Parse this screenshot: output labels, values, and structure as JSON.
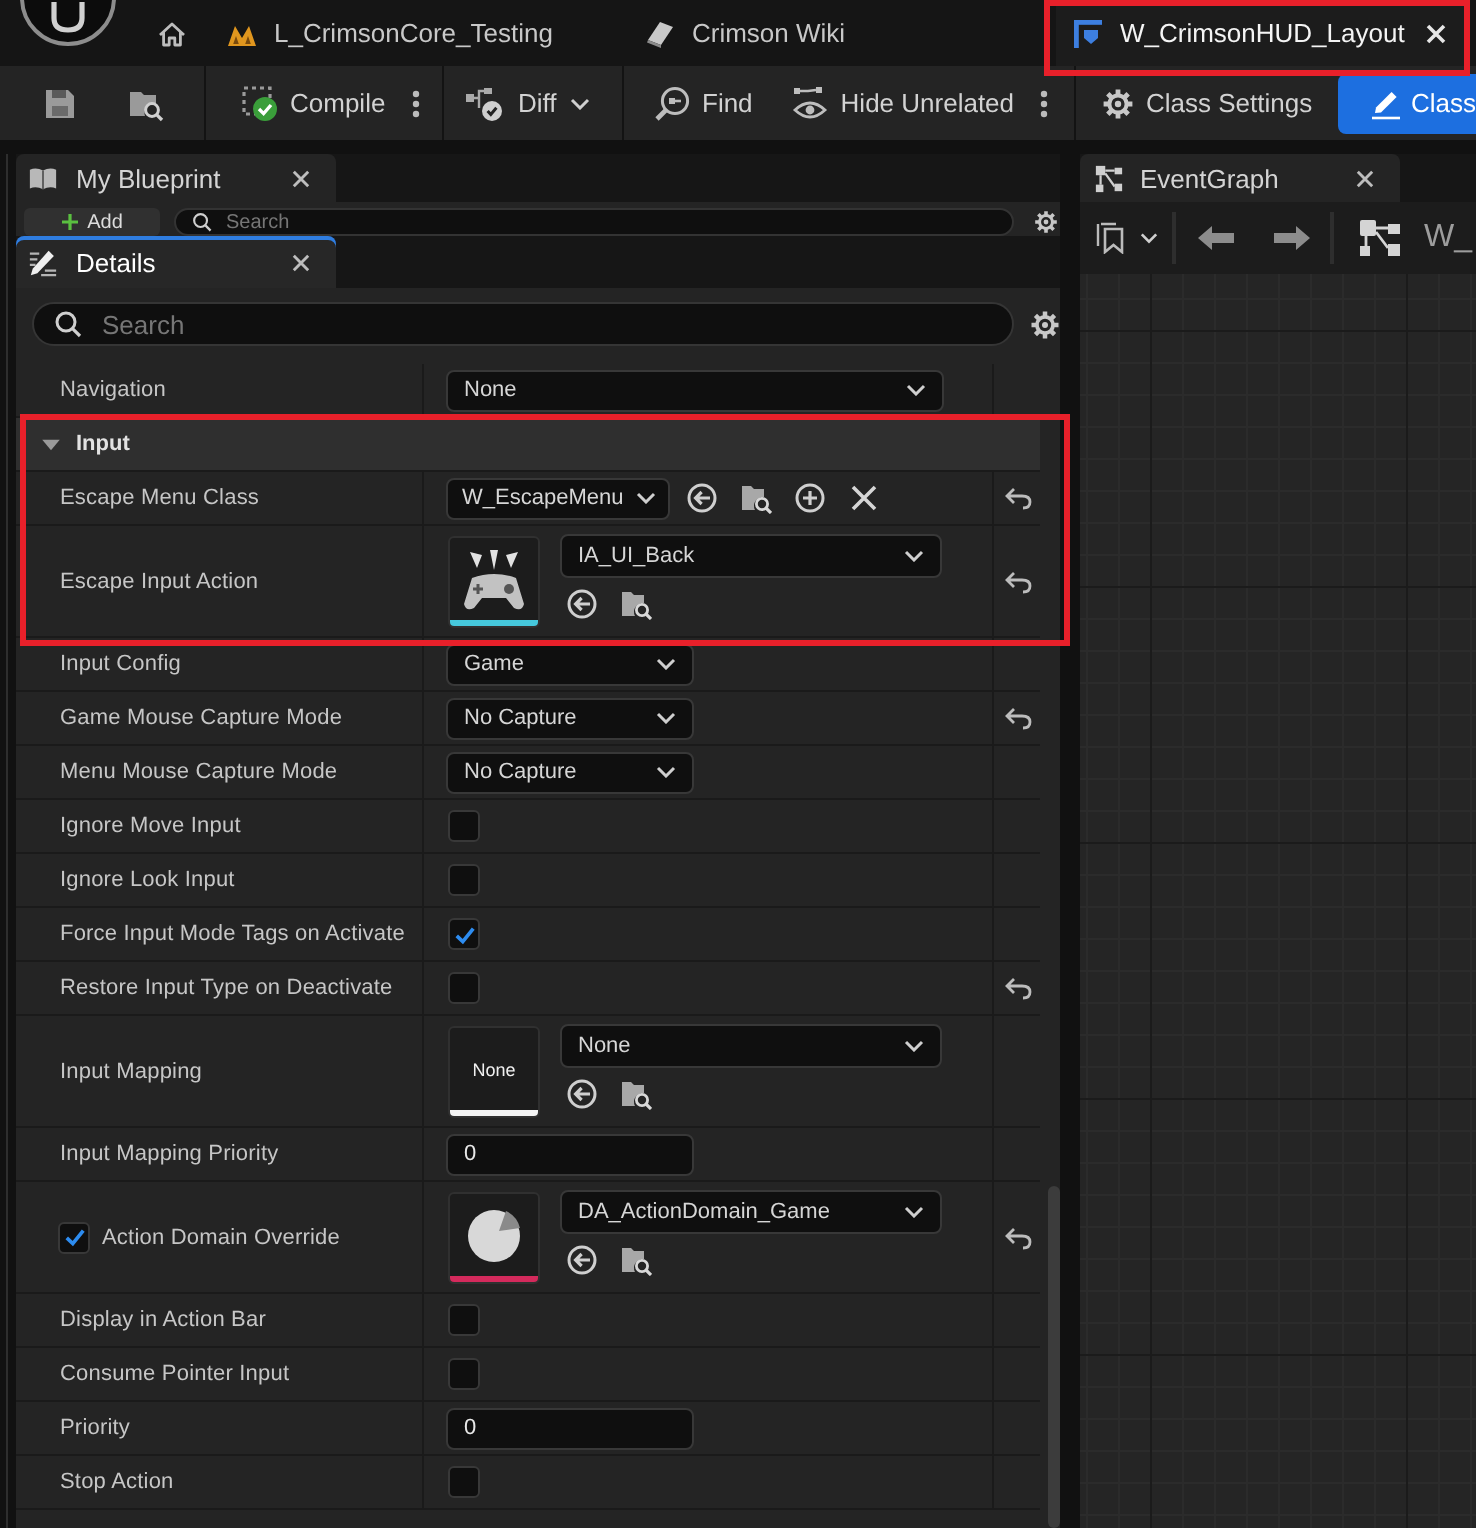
{
  "tabs": [
    {
      "kind": "level",
      "label": "L_CrimsonCore_Testing",
      "selected": false,
      "highlighted": false
    },
    {
      "kind": "wiki",
      "label": "Crimson Wiki",
      "selected": false,
      "highlighted": false
    },
    {
      "kind": "widget",
      "label": "W_CrimsonHUD_Layout",
      "selected": true,
      "highlighted": true
    }
  ],
  "toolbar": {
    "groups": [
      {
        "items": [
          {
            "kind": "save"
          },
          {
            "kind": "browse"
          }
        ]
      },
      {
        "items": [
          {
            "kind": "compile",
            "label": "Compile",
            "options": true
          }
        ]
      },
      {
        "items": [
          {
            "kind": "diff",
            "label": "Diff",
            "dropdown": true
          }
        ]
      },
      {
        "items": [
          {
            "kind": "find",
            "label": "Find"
          },
          {
            "kind": "hide",
            "label": "Hide Unrelated",
            "options": true
          }
        ]
      },
      {
        "items": [
          {
            "kind": "settings",
            "label": "Class Settings",
            "selected": false
          },
          {
            "kind": "defaults",
            "label": "Class",
            "selected": true
          }
        ]
      }
    ]
  },
  "my_blueprint": {
    "tab": {
      "label": "My Blueprint",
      "focused": false
    },
    "add_button": {
      "label": "Add"
    },
    "search": {
      "placeholder": "Search"
    }
  },
  "details": {
    "tab": {
      "label": "Details",
      "focused": true
    },
    "search": {
      "placeholder": "Search"
    },
    "properties": [
      {
        "kind": "combo",
        "label": "Navigation",
        "value": "None",
        "reset": false
      }
    ],
    "categories": [
      {
        "label": "Input",
        "expanded": true,
        "highlighted": true,
        "properties": [
          {
            "kind": "class",
            "label": "Escape Menu Class",
            "value": "W_EscapeMenu",
            "reset": true,
            "highlighted": true
          },
          {
            "kind": "asset",
            "label": "Escape Input Action",
            "value": "IA_UI_Back",
            "thumbnail": {
              "kind": "gamepad"
            },
            "color": "#46c8dc",
            "reset": true,
            "highlighted": true
          },
          {
            "kind": "enum",
            "label": "Input Config",
            "value": "Game",
            "reset": false,
            "highlighted": false
          },
          {
            "kind": "enum",
            "label": "Game Mouse Capture Mode",
            "value": "No Capture",
            "reset": true,
            "highlighted": false
          },
          {
            "kind": "enum",
            "label": "Menu Mouse Capture Mode",
            "value": "No Capture",
            "reset": false,
            "highlighted": false
          },
          {
            "kind": "checkbox",
            "label": "Ignore Move Input",
            "checked": false,
            "reset": false,
            "highlighted": false
          },
          {
            "kind": "checkbox",
            "label": "Ignore Look Input",
            "checked": false,
            "reset": false,
            "highlighted": false
          },
          {
            "kind": "checkbox",
            "label": "Force Input Mode Tags on Activate",
            "checked": true,
            "reset": false,
            "highlighted": false
          },
          {
            "kind": "checkbox",
            "label": "Restore Input Type on Deactivate",
            "checked": false,
            "reset": true,
            "highlighted": false
          },
          {
            "kind": "asset",
            "label": "Input Mapping",
            "value": "None",
            "thumbnail": {
              "kind": "text",
              "label": "None"
            },
            "color": "#f4f4f4",
            "reset": false,
            "highlighted": false
          },
          {
            "kind": "number",
            "label": "Input Mapping Priority",
            "value": "0",
            "reset": false,
            "highlighted": false
          },
          {
            "kind": "asset",
            "label": "Action Domain Override",
            "value": "DA_ActionDomain_Game",
            "thumbnail": {
              "kind": "pie"
            },
            "color": "#d42a5c",
            "edit_condition": {
              "checked": true
            },
            "reset": true,
            "highlighted": false
          },
          {
            "kind": "checkbox",
            "label": "Display in Action Bar",
            "checked": false,
            "reset": false,
            "highlighted": false
          },
          {
            "kind": "checkbox",
            "label": "Consume Pointer Input",
            "checked": false,
            "reset": false,
            "highlighted": false
          },
          {
            "kind": "number",
            "label": "Priority",
            "value": "0",
            "reset": false,
            "highlighted": false
          },
          {
            "kind": "checkbox",
            "label": "Stop Action",
            "checked": false,
            "reset": false,
            "highlighted": false
          }
        ]
      }
    ]
  },
  "event_graph": {
    "tab": {
      "label": "EventGraph",
      "focused": false
    },
    "breadcrumb": "W_"
  }
}
